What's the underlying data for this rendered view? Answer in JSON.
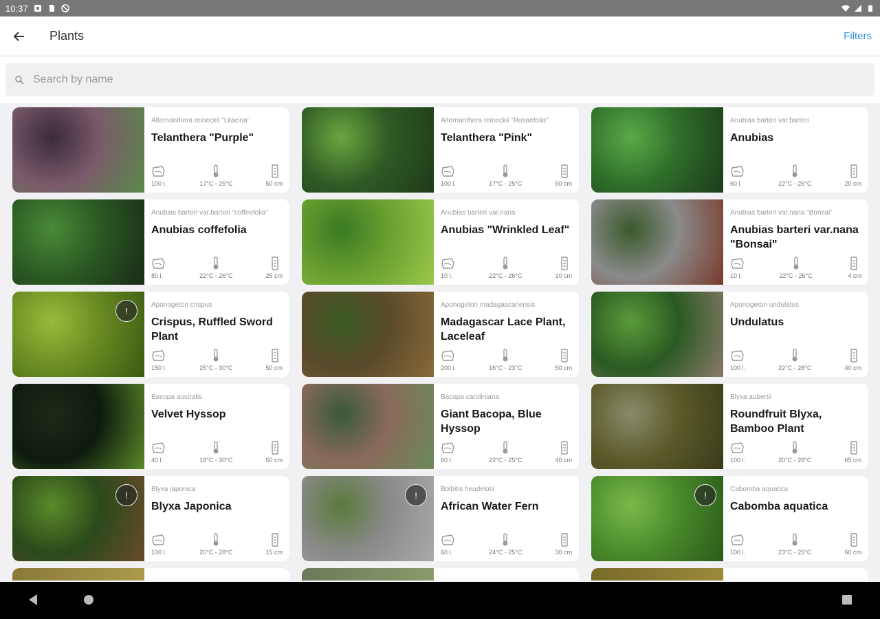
{
  "status_bar": {
    "time": "10:37"
  },
  "app_bar": {
    "title": "Plants",
    "filters_label": "Filters"
  },
  "search": {
    "placeholder": "Search by name"
  },
  "plants": [
    {
      "scientific": "Alternanthera reineckii \"Lilacina\"",
      "common": "Telanthera \"Purple\"",
      "volume": "100 l.",
      "temp": "17°C - 25°C",
      "height": "50 cm",
      "badge": false,
      "colors": [
        "#7a5a6a",
        "#3a2a3a",
        "#5a8a4a"
      ]
    },
    {
      "scientific": "Alternanthera reineckii \"Rosaefolia\"",
      "common": "Telanthera \"Pink\"",
      "volume": "100 l.",
      "temp": "17°C - 25°C",
      "height": "50 cm",
      "badge": false,
      "colors": [
        "#2e5a24",
        "#6aa640",
        "#1e3a18"
      ]
    },
    {
      "scientific": "Anubias barteri var.barteri",
      "common": "Anubias",
      "volume": "60 l.",
      "temp": "22°C - 26°C",
      "height": "20 cm",
      "badge": false,
      "colors": [
        "#2f6e2a",
        "#5aaa48",
        "#1c3a1a"
      ]
    },
    {
      "scientific": "Anubias barteri var.barteri \"coffeefolia\"",
      "common": "Anubias coffefolia",
      "volume": "80 l.",
      "temp": "22°C - 26°C",
      "height": "25 cm",
      "badge": false,
      "colors": [
        "#2a5a22",
        "#4a8a38",
        "#1a2a18"
      ]
    },
    {
      "scientific": "Anubias barteri var.nana",
      "common": "Anubias \"Wrinkled Leaf\"",
      "volume": "10 l.",
      "temp": "22°C - 26°C",
      "height": "10 cm",
      "badge": false,
      "colors": [
        "#6aa030",
        "#3a7a22",
        "#9ac84a"
      ]
    },
    {
      "scientific": "Anubias barteri var.nana \"Bonsai\"",
      "common": "Anubias barteri var.nana \"Bonsai\"",
      "volume": "10 l.",
      "temp": "22°C - 26°C",
      "height": "4 cm",
      "badge": false,
      "colors": [
        "#8a8a8a",
        "#3a5a2a",
        "#7a3a2a"
      ]
    },
    {
      "scientific": "Aponogeton crispus",
      "common": "Crispus, Ruffled Sword Plant",
      "volume": "150 l.",
      "temp": "25°C - 30°C",
      "height": "50 cm",
      "badge": true,
      "colors": [
        "#6a8a22",
        "#9aba3a",
        "#3a5a12"
      ]
    },
    {
      "scientific": "Aponogeton madagascariensis",
      "common": "Madagascar Lace Plant, Laceleaf",
      "volume": "200 l.",
      "temp": "16°C - 23°C",
      "height": "50 cm",
      "badge": false,
      "colors": [
        "#5a4a2a",
        "#3a5a22",
        "#8a6a3a"
      ]
    },
    {
      "scientific": "Aponogeton undulatus",
      "common": "Undulatus",
      "volume": "100 l.",
      "temp": "22°C - 28°C",
      "height": "40 cm",
      "badge": false,
      "colors": [
        "#2a5a22",
        "#5a9a3a",
        "#8a7a6a"
      ]
    },
    {
      "scientific": "Bacopa australis",
      "common": "Velvet Hyssop",
      "volume": "40 l.",
      "temp": "18°C - 30°C",
      "height": "50 cm",
      "badge": false,
      "colors": [
        "#0e1a0e",
        "#1e2a18",
        "#5a8a2a"
      ]
    },
    {
      "scientific": "Bacopa caroliniana",
      "common": "Giant Bacopa, Blue Hyssop",
      "volume": "60 l.",
      "temp": "22°C - 25°C",
      "height": "40 cm",
      "badge": false,
      "colors": [
        "#8a6a5a",
        "#3a5a3a",
        "#6a8a5a"
      ]
    },
    {
      "scientific": "Blyxa aubertii",
      "common": "Roundfruit Blyxa, Bamboo Plant",
      "volume": "100 l.",
      "temp": "20°C - 28°C",
      "height": "65 cm",
      "badge": false,
      "colors": [
        "#5a5a2a",
        "#8a8a6a",
        "#3a3a1a"
      ]
    },
    {
      "scientific": "Blyxa japonica",
      "common": "Blyxa Japonica",
      "volume": "100 l.",
      "temp": "20°C - 28°C",
      "height": "15 cm",
      "badge": true,
      "colors": [
        "#2a4a1a",
        "#5a8a2a",
        "#6a4a2a"
      ]
    },
    {
      "scientific": "Bolbitis heudelotii",
      "common": "African Water Fern",
      "volume": "60 l.",
      "temp": "24°C - 25°C",
      "height": "30 cm",
      "badge": true,
      "colors": [
        "#8a8a8a",
        "#5a7a3a",
        "#aaaaaa"
      ]
    },
    {
      "scientific": "Cabomba aquatica",
      "common": "Cabomba aquatica",
      "volume": "100 l.",
      "temp": "23°C - 25°C",
      "height": "60 cm",
      "badge": true,
      "colors": [
        "#4a8a2a",
        "#7aba4a",
        "#2a5a1a"
      ]
    }
  ]
}
